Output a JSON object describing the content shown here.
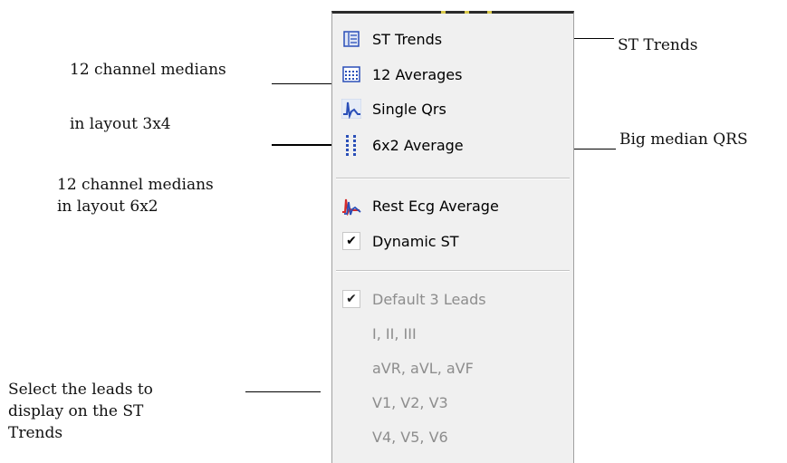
{
  "annotations": {
    "medians_3x4_line1": "12 channel medians",
    "medians_3x4_line2": "in layout 3x4",
    "medians_6x2_line1": "12 channel medians",
    "medians_6x2_line2": "in layout 6x2",
    "st_trends": "ST Trends",
    "big_median": "Big median QRS",
    "select_leads_line1": "Select the leads to",
    "select_leads_line2": "display on the ST",
    "select_leads_line3": "Trends"
  },
  "menu": {
    "items": [
      {
        "label": "ST Trends",
        "icon": "st-trends-icon"
      },
      {
        "label": "12 Averages",
        "icon": "grid-averages-icon"
      },
      {
        "label": "Single Qrs",
        "icon": "qrs-wave-icon"
      },
      {
        "label": "6x2 Average",
        "icon": "dots-6x2-icon"
      },
      {
        "label": "Rest Ecg Average",
        "icon": "rest-ecg-icon"
      },
      {
        "label": "Dynamic ST",
        "checked": true
      },
      {
        "label": "Default 3 Leads",
        "checked": true,
        "disabled": true
      },
      {
        "label": "I, II, III",
        "disabled": true
      },
      {
        "label": "aVR, aVL, aVF",
        "disabled": true
      },
      {
        "label": "V1, V2, V3",
        "disabled": true
      },
      {
        "label": "V4, V5, V6",
        "disabled": true
      }
    ],
    "check_glyph": "✔"
  },
  "colors": {
    "menu_bg": "#f0f0f0",
    "disabled_text": "#8d8d8d",
    "icon_blue": "#2a4fb8",
    "icon_red": "#d42b2b"
  }
}
